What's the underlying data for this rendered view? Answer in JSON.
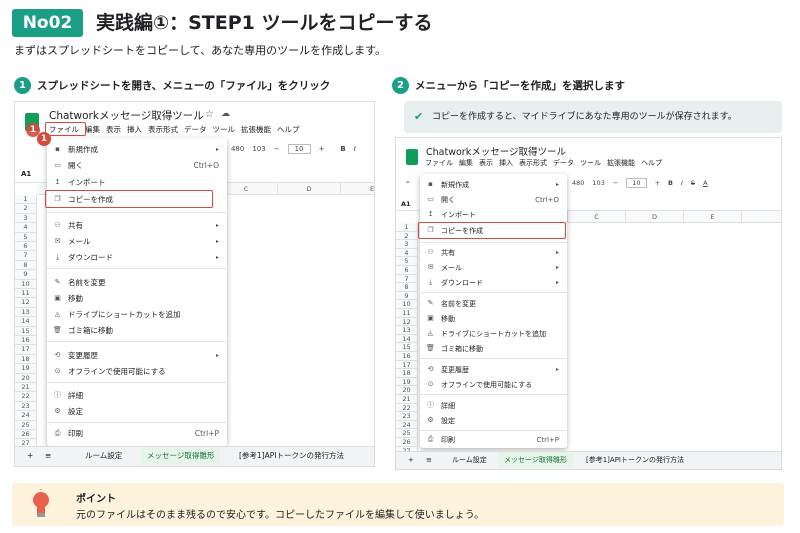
{
  "header": {
    "badge": "No02",
    "title": "実践編①：STEP1 ツールをコピーする",
    "subtitle": "まずはスプレッドシートをコピーして、あなた専用のツールを作成します。"
  },
  "steps": [
    {
      "num": "1",
      "text": "スプレッドシートを開き、メニューの「ファイル」をクリック"
    },
    {
      "num": "2",
      "text": "メニューから「コピーを作成」を選択します"
    }
  ],
  "note": {
    "text": "コピーを作成すると、マイドライブにあなた専用のツールが保存されます。"
  },
  "sheet": {
    "doc_title": "Chatworkメッセージ取得ツール",
    "menubar": [
      "ファイル",
      "編集",
      "表示",
      "挿入",
      "表示形式",
      "データ",
      "ツール",
      "拡張機能",
      "ヘルプ"
    ],
    "toolbar_left": {
      "zoom": "480",
      "zoom2": "103",
      "font_size": "10",
      "bold": "B",
      "italic": "I"
    },
    "toolbar_right": {
      "zoom": "480",
      "zoom2": "103",
      "font_size": "10",
      "bold": "B",
      "italic": "I",
      "strike": "S",
      "color": "A"
    },
    "cell_ref": "A1",
    "cell_ref2": "A1",
    "columns": [
      "C",
      "D",
      "E"
    ],
    "rows": [
      "1",
      "2",
      "3",
      "4",
      "5",
      "6",
      "7",
      "8",
      "9",
      "10",
      "11",
      "12",
      "13",
      "14",
      "15",
      "16",
      "17",
      "18",
      "19",
      "20",
      "21",
      "22",
      "23",
      "24",
      "25",
      "26",
      "27"
    ],
    "rows_right": [
      "1",
      "2",
      "3",
      "4",
      "5",
      "6",
      "7",
      "8",
      "9",
      "10",
      "11",
      "12",
      "13",
      "14",
      "15",
      "16",
      "17",
      "18",
      "19",
      "20",
      "21",
      "22",
      "23",
      "24",
      "25",
      "26",
      "27"
    ],
    "menu": {
      "new": "新規作成",
      "open": "開く",
      "open_shortcut": "Ctrl+O",
      "import": "インポート",
      "copy": "コピーを作成",
      "share": "共有",
      "mail": "メール",
      "download": "ダウンロード",
      "rename": "名前を変更",
      "move": "移動",
      "shortcut": "ドライブにショートカットを追加",
      "trash": "ゴミ箱に移動",
      "history": "変更履歴",
      "offline": "オフラインで使用可能にする",
      "details": "詳細",
      "settings": "設定",
      "print": "印刷",
      "print_shortcut": "Ctrl+P"
    },
    "tabs": {
      "add": "+",
      "list": "≡",
      "tab1": "ルーム設定",
      "tab2": "メッセージ取得雛形",
      "tab3": "[参考1]APIトークンの発行方法"
    },
    "marker": "1"
  },
  "tip": {
    "title": "ポイント",
    "body": "元のファイルはそのまま残るので安心です。コピーしたファイルを編集して使いましょう。"
  },
  "colors": {
    "accent": "#1a9e86",
    "highlight": "#d44a3c",
    "tip_bg": "#fdf3dc",
    "note_bg": "#e8f0ef"
  }
}
